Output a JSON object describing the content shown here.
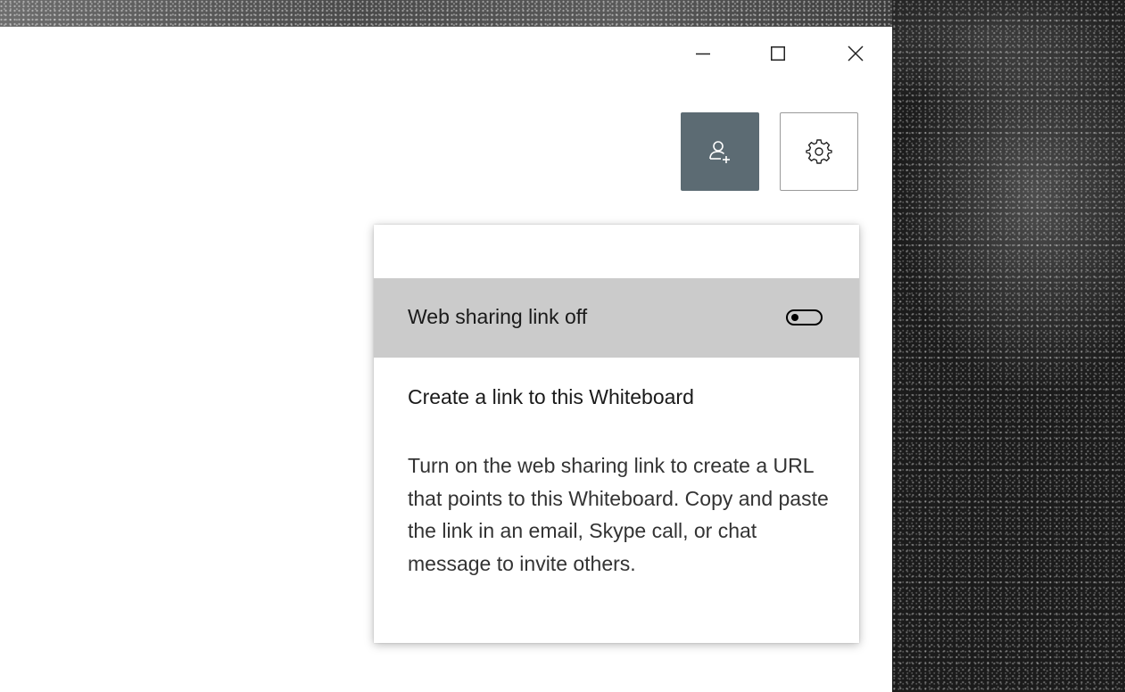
{
  "window": {
    "caption_buttons": {
      "minimize_icon": "minimize-icon",
      "maximize_icon": "maximize-icon",
      "close_icon": "close-icon"
    }
  },
  "toolbar": {
    "share_button_icon": "add-person-icon",
    "share_button_color": "#5c6b73",
    "settings_button_icon": "gear-icon"
  },
  "share_panel": {
    "toggle_label": "Web sharing link off",
    "toggle_state": "off",
    "heading": "Create a link to this Whiteboard",
    "description": "Turn on the web sharing link to create a URL that points to this Whiteboard. Copy and paste the link in an email, Skype call, or chat message to invite others.",
    "toggle_row_color": "#cbcbcb"
  }
}
